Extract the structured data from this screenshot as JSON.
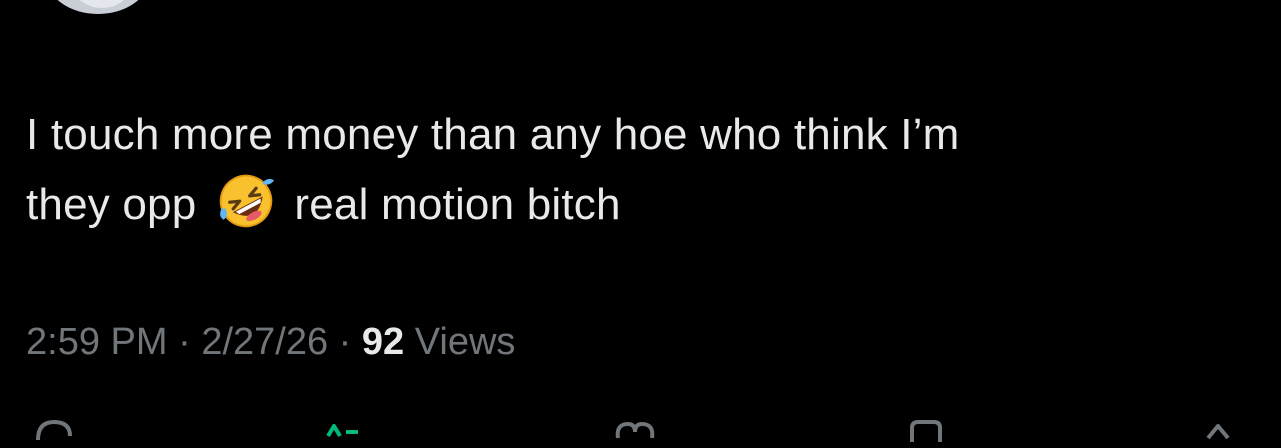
{
  "tweet": {
    "text_line1": "I touch more money than any hoe who think I’m",
    "text_line2_before": "they opp",
    "emoji": "rolling-on-floor-laughing-emoji",
    "text_line2_after": "real motion bitch",
    "time": "2:59 PM",
    "separator": "·",
    "date": "2/27/26",
    "views_count": "92",
    "views_label": "Views"
  },
  "actions": {
    "icons": [
      "reply-icon",
      "repost-icon",
      "like-icon",
      "bookmark-icon",
      "share-icon"
    ],
    "repost_color": "#00ba7c"
  },
  "colors": {
    "background": "#000000",
    "text": "#e7e9ea",
    "muted": "#71767b"
  }
}
